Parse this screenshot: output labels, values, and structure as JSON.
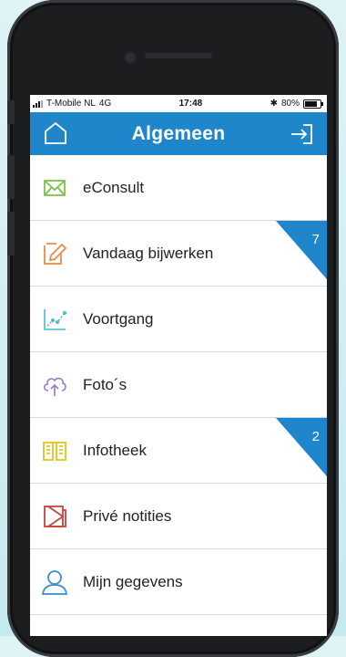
{
  "status_bar": {
    "carrier": "T-Mobile NL",
    "network": "4G",
    "time": "17:48",
    "battery": "80%",
    "battery_level": 0.8
  },
  "header": {
    "title": "Algemeen",
    "home_icon": "home-icon",
    "logout_icon": "logout-icon",
    "color": "#1f86cc"
  },
  "menu": [
    {
      "label": "eConsult",
      "icon": "envelope-icon",
      "color": "#7cc24a",
      "badge": ""
    },
    {
      "label": "Vandaag bijwerken",
      "icon": "pencil-square-icon",
      "color": "#e88a4c",
      "badge": "7"
    },
    {
      "label": "Voortgang",
      "icon": "chart-line-icon",
      "color": "#47bcd6",
      "badge": ""
    },
    {
      "label": "Foto´s",
      "icon": "cloud-upload-icon",
      "color": "#8e7bd2",
      "badge": ""
    },
    {
      "label": "Infotheek",
      "icon": "open-book-icon",
      "color": "#e3c21e",
      "badge": "2"
    },
    {
      "label": "Privé notities",
      "icon": "notes-icon",
      "color": "#c8433c",
      "badge": ""
    },
    {
      "label": "Mijn gegevens",
      "icon": "user-icon",
      "color": "#3b8fd0",
      "badge": ""
    }
  ]
}
